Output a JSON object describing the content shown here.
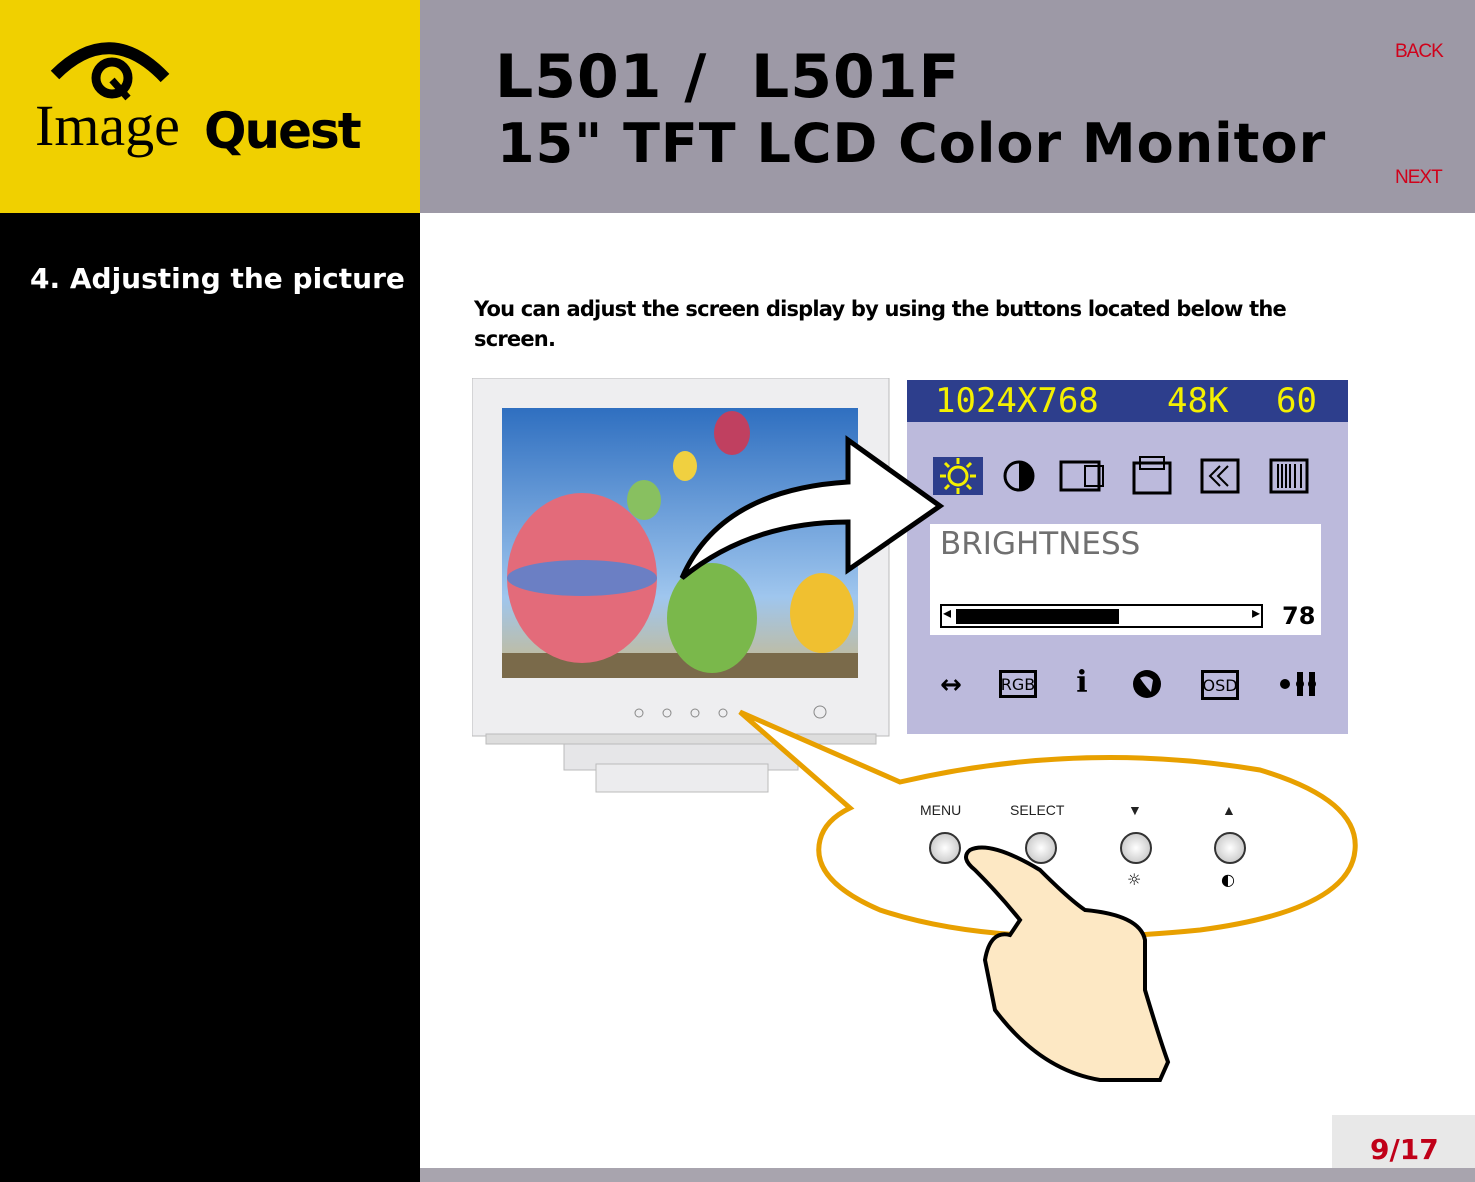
{
  "logo": {
    "text": "ImageQuest"
  },
  "header": {
    "model": "L501 /  L501F",
    "subtitle": "15\" TFT LCD Color Monitor",
    "back": "BACK",
    "next": "NEXT"
  },
  "sidebar": {
    "section": "4. Adjusting the picture"
  },
  "main": {
    "intro": "You can adjust the screen display by using the buttons located below the screen."
  },
  "osd": {
    "resolution": "1024X768",
    "hfreq": "48K",
    "vfreq": "60",
    "top_icons": [
      "brightness-icon",
      "contrast-icon",
      "h-position-icon",
      "v-position-icon",
      "phase-icon",
      "clock-icon"
    ],
    "selected": "brightness-icon",
    "label": "BRIGHTNESS",
    "value": "78",
    "level_percent": 78,
    "bottom_icons": [
      "h-size-icon",
      "rgb-icon",
      "info-icon",
      "language-icon",
      "osd-icon",
      "reset-icon"
    ],
    "rgb": "RGB",
    "osd": "OSD",
    "info": "i",
    "colors": {
      "header": "#2d3e8c",
      "header_text": "#f4f000",
      "panel": "#bcbadc"
    }
  },
  "controls": {
    "menu": "MENU",
    "select": "SELECT",
    "down": "▼",
    "up": "▲"
  },
  "footer": {
    "page": "9/17"
  },
  "colors": {
    "yellow": "#f0d000",
    "header_gray": "#9d99a6",
    "link_red": "#d0021b",
    "callout": "#e8a000"
  }
}
